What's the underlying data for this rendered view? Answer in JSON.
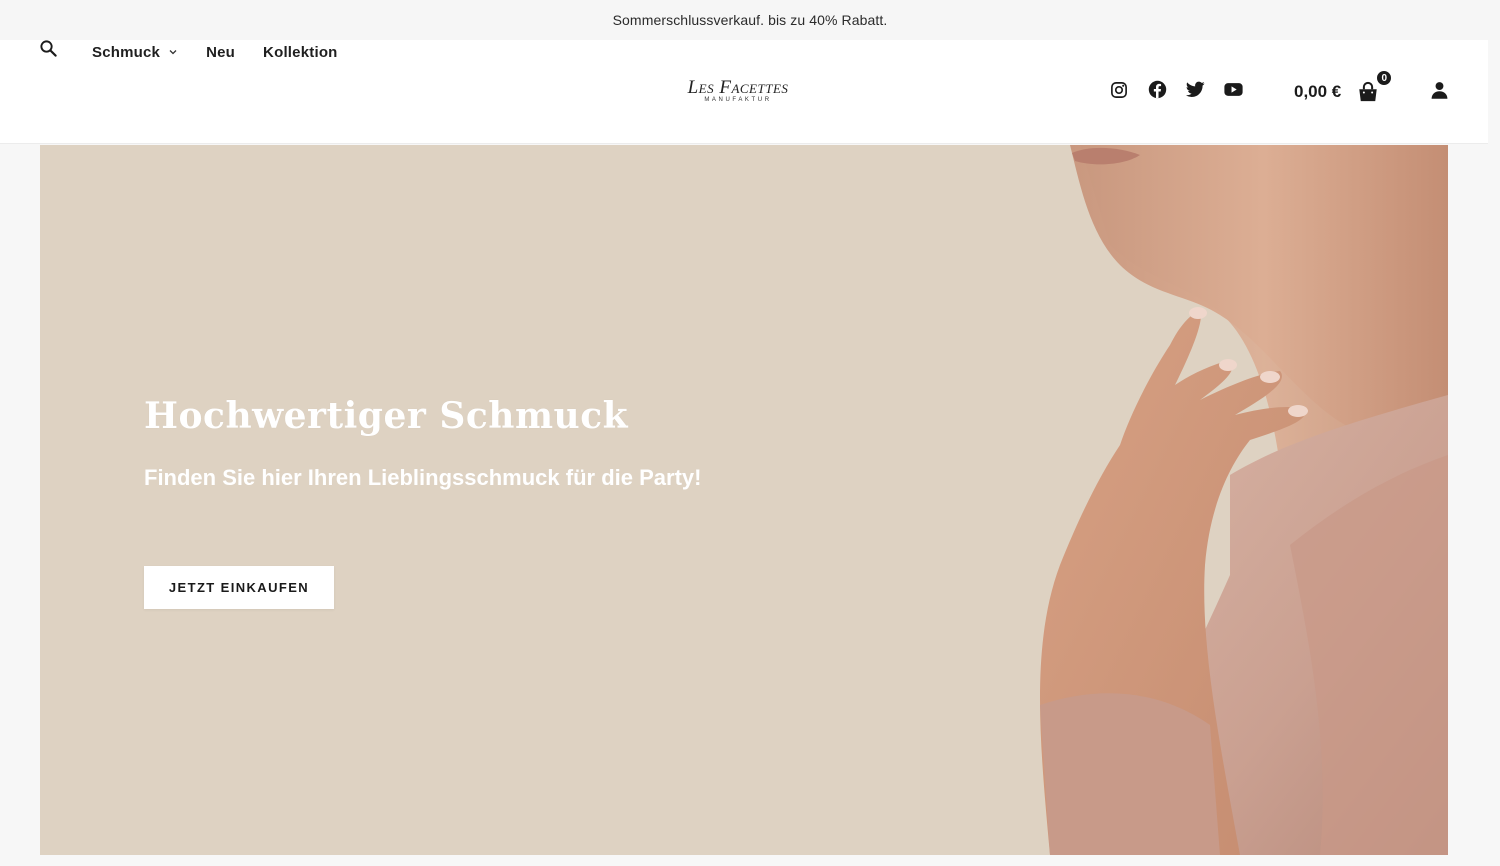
{
  "announcement": {
    "text": "Sommerschlussverkauf. bis zu 40% Rabatt."
  },
  "header": {
    "search_icon": "search-icon",
    "nav": [
      {
        "label": "Schmuck",
        "has_dropdown": true
      },
      {
        "label": "Neu",
        "has_dropdown": false
      },
      {
        "label": "Kollektion",
        "has_dropdown": false
      }
    ],
    "logo": {
      "main": "Les Facettes",
      "sub": "MANUFAKTUR"
    },
    "social": [
      {
        "icon": "instagram-icon"
      },
      {
        "icon": "facebook-icon"
      },
      {
        "icon": "twitter-icon"
      },
      {
        "icon": "youtube-icon"
      }
    ],
    "cart": {
      "total": "0,00 €",
      "count": "0",
      "icon": "shopping-bag-icon"
    },
    "account_icon": "user-icon"
  },
  "hero": {
    "title": "Hochwertiger Schmuck",
    "subtitle": "Finden Sie hier Ihren Lieblingsschmuck für die Party!",
    "button_label": "JETZT EINKAUFEN",
    "background_color": "#ded2c2"
  },
  "colors": {
    "text_dark": "#1b1b1b",
    "header_bg": "#ffffff",
    "page_bg": "#f7f7f7",
    "button_bg": "#ffffff"
  }
}
